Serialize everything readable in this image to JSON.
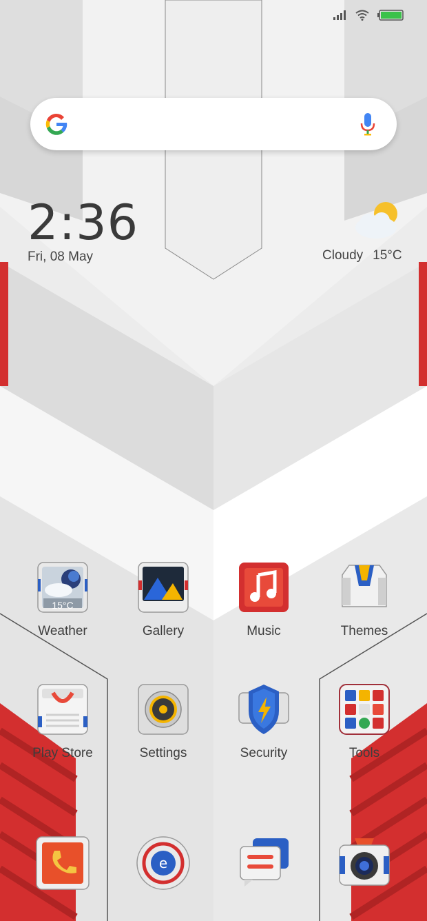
{
  "status_bar": {
    "icons": [
      "signal-icon",
      "wifi-icon",
      "battery-icon"
    ]
  },
  "search_bar": {
    "icons": [
      "google-logo-icon",
      "microphone-icon"
    ]
  },
  "clock_widget": {
    "time": "2:36",
    "date": "Fri, 08 May"
  },
  "weather_widget": {
    "condition": "Cloudy",
    "temperature": "15°C"
  },
  "apps_row1": [
    {
      "label": "Weather",
      "badge": "15°C"
    },
    {
      "label": "Gallery"
    },
    {
      "label": "Music"
    },
    {
      "label": "Themes"
    }
  ],
  "apps_row2": [
    {
      "label": "Play Store"
    },
    {
      "label": "Settings"
    },
    {
      "label": "Security"
    },
    {
      "label": "Tools"
    }
  ],
  "dock": [
    {
      "icon": "phone-icon"
    },
    {
      "icon": "browser-icon"
    },
    {
      "icon": "messages-icon"
    },
    {
      "icon": "camera-icon"
    }
  ],
  "colors": {
    "accent_red": "#d32f2f",
    "wallpaper_light": "#ececec",
    "text": "#3d3d3d"
  }
}
